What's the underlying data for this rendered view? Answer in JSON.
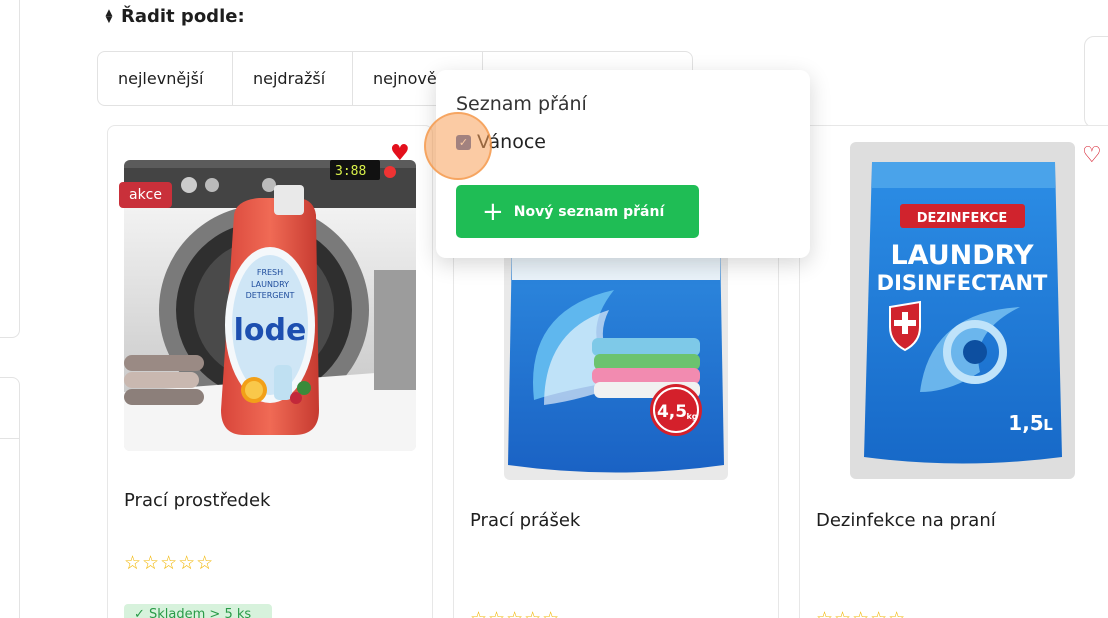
{
  "sort": {
    "title": "Řadit podle:",
    "options": [
      "nejlevnější",
      "nejdražší",
      "nejnově",
      ""
    ]
  },
  "products": [
    {
      "name": "Prací prostředek",
      "badge": "akce",
      "wishlisted": true,
      "rating": 0,
      "stars": "☆☆☆☆☆",
      "stock": "✓ Skladem > 5 ks"
    },
    {
      "name": "Prací prášek",
      "rating": 0,
      "stars": "☆☆☆☆☆"
    },
    {
      "name": "Dezinfekce na praní",
      "wishlisted": false,
      "rating": 0,
      "stars": "☆☆☆☆☆"
    }
  ],
  "images": {
    "detergent": {
      "washer_display": "3:88",
      "bottle_small": "FRESH",
      "bottle_label_1": "LAUNDRY",
      "bottle_label_2": "DETERGENT",
      "brand": "lode"
    },
    "powder": {
      "weight_big": "4,5",
      "weight_unit": "kg"
    },
    "disinfectant": {
      "tag": "DEZINFEKCE",
      "line1": "LAUNDRY",
      "line2": "DISINFECTANT",
      "volume": "1,5",
      "unit": "L"
    }
  },
  "wishlist_popover": {
    "title": "Seznam přání",
    "lists": [
      {
        "label": "Vánoce",
        "checked": true
      }
    ],
    "new_list_button": "Nový seznam přání"
  },
  "colors": {
    "accent_green": "#1fbd55",
    "badge_red": "#c9303a",
    "heart_red": "#e3101c",
    "star": "#f2b600"
  }
}
